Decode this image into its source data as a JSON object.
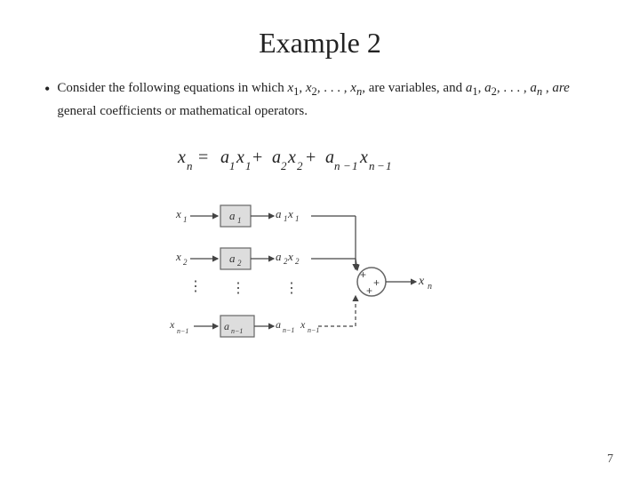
{
  "title": "Example 2",
  "bullet": {
    "text_parts": [
      "Consider the following equations in which ",
      "x",
      "1",
      ", ",
      "x",
      "2",
      ", . . . , ",
      "x",
      "n",
      ", are variables,  and ",
      "a",
      "1",
      ", ",
      "a",
      "2",
      ", . . . , ",
      "a",
      "n",
      " , ",
      "are",
      " general coefficients or mathematical operators."
    ]
  },
  "page_number": "7"
}
